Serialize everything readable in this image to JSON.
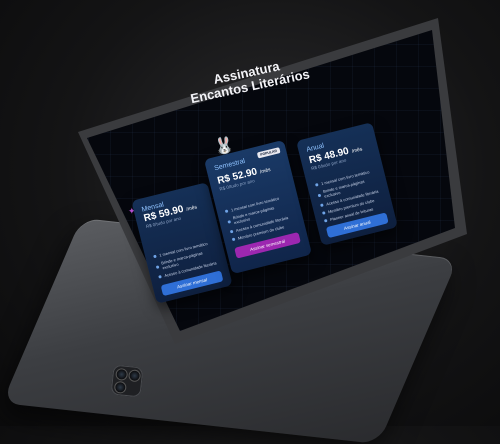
{
  "title": {
    "line1": "Assinatura",
    "line2": "Encantos Literários"
  },
  "plans": [
    {
      "name": "Mensal",
      "price": "R$ 59.90",
      "period": "/mês",
      "sub": "R$ 0/tudo por ano",
      "features": [
        "1 mensal com livro temático",
        "Brinde e marca-páginas exclusivo",
        "Acesso à comunidade literária"
      ],
      "button": "Assinar mensal",
      "button_color": "#2f6fd6"
    },
    {
      "name": "Semestral",
      "badge": "POPULAR",
      "price": "R$ 52.90",
      "period": "/mês",
      "sub": "R$ 0/tudo por ano",
      "features": [
        "1 mensal com livro temático",
        "Brinde e marca-páginas exclusivo",
        "Acesso à comunidade literária",
        "Membro premium do clube"
      ],
      "button": "Assinar semestral",
      "button_color": "#9c27b0"
    },
    {
      "name": "Anual",
      "price": "R$ 48.90",
      "period": "/mês",
      "sub": "R$ 0/tudo por ano",
      "features": [
        "1 mensal com livro temático",
        "Brinde e marca-páginas exclusivo",
        "Acesso à comunidade literária",
        "Membro premium do clube",
        "Planner anual de leituras"
      ],
      "button": "Assinar anual",
      "button_color": "#2f6fd6"
    }
  ],
  "icons": {
    "mascot": "bunny-icon",
    "sparkle": "sparkle-icon",
    "feature": "dot-icon"
  },
  "colors": {
    "accent_blue": "#2f6fd6",
    "accent_purple": "#9c27b0",
    "screen_bg": "#05070d"
  }
}
